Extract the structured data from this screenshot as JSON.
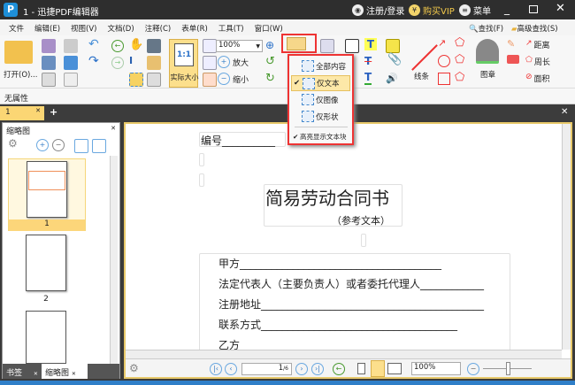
{
  "app": {
    "title": "1 - 迅捷PDF编辑器",
    "logo": "P",
    "login": "注册/登录",
    "vip": "购买VIP",
    "vip_icon": "¥",
    "menu": "菜单"
  },
  "menubar": [
    "文件",
    "编辑(E)",
    "视图(V)",
    "文档(D)",
    "注释(C)",
    "表单(R)",
    "工具(T)",
    "窗口(W)"
  ],
  "ribbon": {
    "open": "打开(O)...",
    "actual_size": "实际大小",
    "actual_size_icon": "1:1",
    "zoom_value": "100%",
    "zoom_in": "放大",
    "zoom_out": "缩小",
    "find": "查找(F)",
    "advanced_find": "高级查找(S)",
    "lines": "线条",
    "stamp": "图章",
    "distance": "距离",
    "perimeter": "周长",
    "area": "面积"
  },
  "properties": {
    "label": "无属性"
  },
  "tabs": {
    "doc_tab": "1"
  },
  "dropdown": {
    "items": [
      {
        "label": "全部内容",
        "checked": false
      },
      {
        "label": "仅文本",
        "checked": true
      },
      {
        "label": "仅图像",
        "checked": false
      },
      {
        "label": "仅形状",
        "checked": false
      }
    ],
    "highlight": "高亮显示文本块",
    "highlight_checked": true
  },
  "leftpanel": {
    "title": "缩略图",
    "pages": [
      "1",
      "2"
    ],
    "tab_bookmarks": "书签",
    "tab_thumbnails": "缩略图"
  },
  "document": {
    "number": "编号__________",
    "title": "简易劳动合同书",
    "subtitle": "（参考文本）",
    "lines": [
      "甲方______________________________________",
      "法定代表人（主要负责人）或者委托代理人____________",
      "注册地址__________________________________________",
      "联系方式_____________________________________",
      "乙方______________________________________"
    ]
  },
  "status": {
    "page": "1",
    "total": "/6",
    "zoom": "100%"
  },
  "colors": {
    "accent": "#fbd674",
    "highlight_box": "#e33333",
    "titlebar": "#2e2e2e"
  }
}
